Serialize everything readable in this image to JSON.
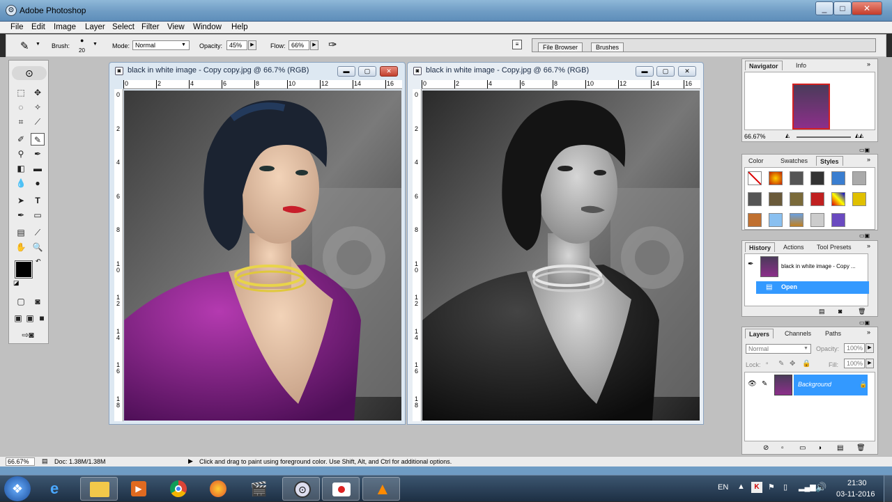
{
  "window": {
    "title": "Adobe Photoshop",
    "buttons": [
      "_",
      "□",
      "✕"
    ]
  },
  "menu": [
    "File",
    "Edit",
    "Image",
    "Layer",
    "Select",
    "Filter",
    "View",
    "Window",
    "Help"
  ],
  "options": {
    "brush_label": "Brush:",
    "brush_size": "20",
    "mode_label": "Mode:",
    "mode_value": "Normal",
    "opacity_label": "Opacity:",
    "opacity_value": "45%",
    "flow_label": "Flow:",
    "flow_value": "66%",
    "file_browser": "File Browser",
    "brushes": "Brushes"
  },
  "documents": [
    {
      "title": "black in white image - Copy copy.jpg @ 66.7% (RGB)",
      "ruler_h": [
        "0",
        "2",
        "4",
        "6",
        "8",
        "10",
        "12",
        "14",
        "16"
      ],
      "ruler_v": [
        "0",
        "2",
        "4",
        "6",
        "8",
        "1\n0",
        "1\n2",
        "1\n4",
        "1\n6",
        "1\n8"
      ]
    },
    {
      "title": "black in white image - Copy.jpg @ 66.7% (RGB)",
      "ruler_h": [
        "0",
        "2",
        "4",
        "6",
        "8",
        "10",
        "12",
        "14",
        "16"
      ],
      "ruler_v": [
        "0",
        "2",
        "4",
        "6",
        "8",
        "1\n0",
        "1\n2",
        "1\n4",
        "1\n6",
        "1\n8"
      ]
    }
  ],
  "navigator": {
    "tabs": [
      "Navigator",
      "Info"
    ],
    "zoom": "66.67%"
  },
  "color_panel": {
    "tabs": [
      "Color",
      "Swatches",
      "Styles"
    ]
  },
  "history": {
    "tabs": [
      "History",
      "Actions",
      "Tool Presets"
    ],
    "snapshot": "black in white image - Copy ...",
    "state": "Open"
  },
  "layers": {
    "tabs": [
      "Layers",
      "Channels",
      "Paths"
    ],
    "blend": "Normal",
    "opacity_label": "Opacity:",
    "opacity_value": "100%",
    "lock_label": "Lock:",
    "fill_label": "Fill:",
    "fill_value": "100%",
    "layer_name": "Background"
  },
  "status": {
    "zoom": "66.67%",
    "doc": "Doc: 1.38M/1.38M",
    "hint": "Click and drag to paint using foreground color.  Use Shift, Alt, and Ctrl for additional options."
  },
  "taskbar": {
    "lang": "EN",
    "time": "21:30",
    "date": "03-11-2016"
  },
  "colors": {
    "accent": "#3399ff",
    "taskbar": "#1d2f44",
    "titlebar": "#6f9cc4"
  }
}
